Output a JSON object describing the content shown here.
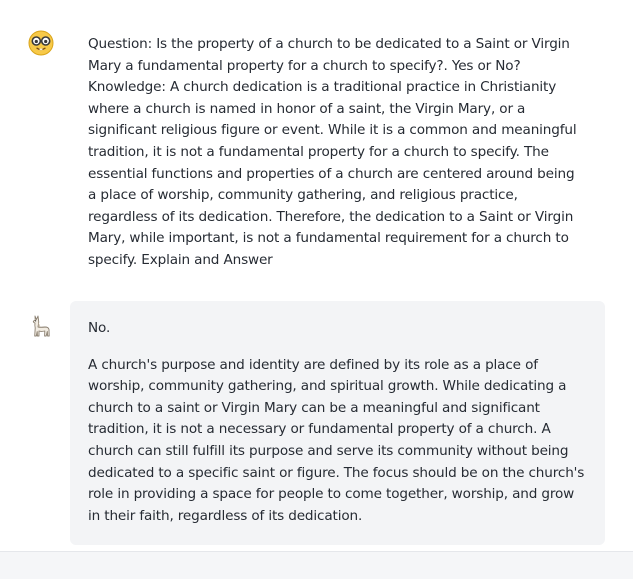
{
  "conversation": {
    "user": {
      "avatar_icon": "nerd-face-glasses-icon",
      "text": "Question: Is the property of a church to be dedicated to a Saint or Virgin Mary a fundamental property for a church to specify?. Yes or No? Knowledge: A church dedication is a traditional practice in Christianity where a church is named in honor of a saint, the Virgin Mary, or a significant religious figure or event. While it is a common and meaningful tradition, it is not a fundamental property for a church to specify. The essential functions and properties of a church are centered around being a place of worship, community gathering, and religious practice, regardless of its dedication. Therefore, the dedication to a Saint or Virgin Mary, while important, is not a fundamental requirement for a church to specify. Explain and Answer"
    },
    "assistant": {
      "avatar_icon": "llama-icon",
      "answer": "No.",
      "explanation": "A church's purpose and identity are defined by its role as a place of worship, community gathering, and spiritual growth. While dedicating a church to a saint or Virgin Mary can be a meaningful and significant tradition, it is not a necessary or fundamental property of a church. A church can still fulfill its purpose and serve its community without being dedicated to a specific saint or figure. The focus should be on the church's role in providing a space for people to come together, worship, and grow in their faith, regardless of its dedication."
    }
  },
  "colors": {
    "bubble_background": "#f3f4f6",
    "text": "#262b33"
  }
}
